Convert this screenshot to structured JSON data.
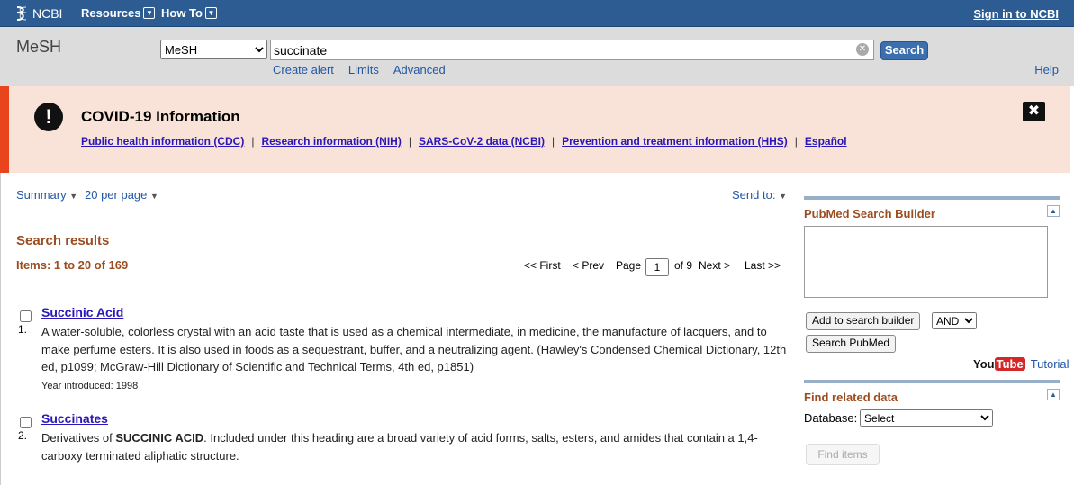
{
  "topbar": {
    "logo_text": "NCBI",
    "resources_label": "Resources",
    "howto_label": "How To",
    "signin_label": "Sign in to NCBI"
  },
  "search": {
    "db_label": "MeSH",
    "db_selected": "MeSH",
    "query_value": "succinate",
    "button_label": "Search",
    "links": [
      "Create alert",
      "Limits",
      "Advanced"
    ],
    "help_label": "Help"
  },
  "covid": {
    "title": "COVID-19 Information",
    "links": [
      "Public health information (CDC)",
      "Research information (NIH)",
      "SARS-CoV-2 data (NCBI)",
      "Prevention and treatment information (HHS)",
      "Español"
    ],
    "separator": "|"
  },
  "display": {
    "summary_label": "Summary",
    "per_page_label": "20 per page",
    "send_to_label": "Send to:"
  },
  "results": {
    "heading": "Search results",
    "items_label": "Items: 1 to 20 of 169",
    "pager": {
      "first": "<< First",
      "prev": "< Prev",
      "page_label": "Page",
      "page_value": "1",
      "of_label": "of 9",
      "next": "Next >",
      "last": "Last >>"
    },
    "list": [
      {
        "num": "1.",
        "title": "Succinic Acid",
        "desc": "A water-soluble, colorless crystal with an acid taste that is used as a chemical intermediate, in medicine, the manufacture of lacquers, and to make perfume esters. It is also used in foods as a sequestrant, buffer, and a neutralizing agent. (Hawley's Condensed Chemical Dictionary, 12th ed, p1099; McGraw-Hill Dictionary of Scientific and Technical Terms, 4th ed, p1851)",
        "year": "Year introduced: 1998"
      },
      {
        "num": "2.",
        "title": "Succinates",
        "desc_pre": "Derivatives of ",
        "desc_bold": "SUCCINIC ACID",
        "desc_post": ". Included under this heading are a broad variety of acid forms, salts, esters, and amides that contain a 1,4-carboxy terminated aliphatic structure."
      }
    ]
  },
  "sidebar": {
    "builder_title": "PubMed Search Builder",
    "add_button": "Add to search builder",
    "bool_selected": "AND",
    "search_pubmed_button": "Search PubMed",
    "youtube_you": "You",
    "youtube_tube": "Tube",
    "tutorial_label": "Tutorial",
    "related_title": "Find related data",
    "database_label": "Database:",
    "database_selected": "Select",
    "find_items_button": "Find items"
  }
}
